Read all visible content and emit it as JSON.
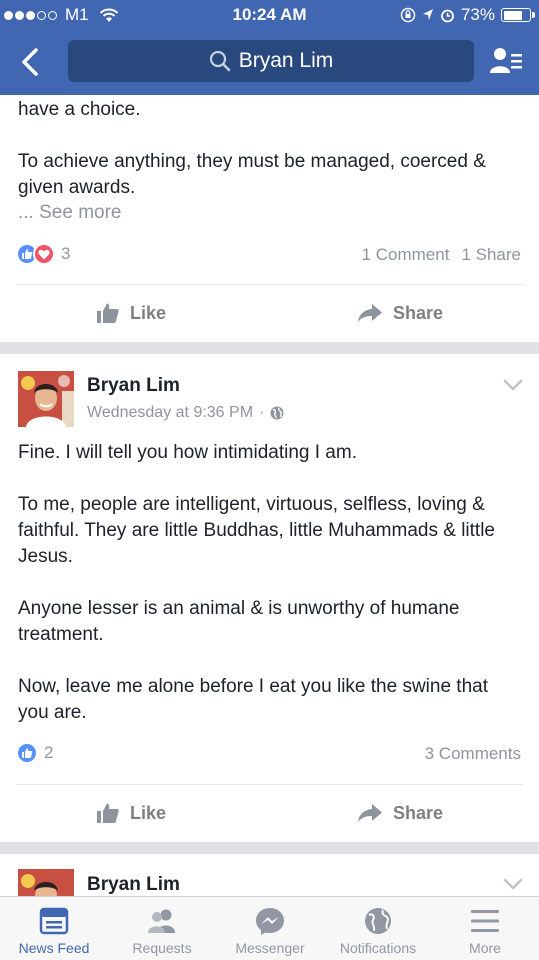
{
  "status_bar": {
    "carrier": "M1",
    "time": "10:24 AM",
    "battery": "73%",
    "battery_level": 0.73
  },
  "header": {
    "search_text": "Bryan Lim"
  },
  "posts": [
    {
      "text_lines": [
        "have a choice.",
        "",
        "To achieve anything, they must be managed, coerced & given awards."
      ],
      "see_more": "... See more",
      "reaction_count": "3",
      "comments": "1 Comment",
      "shares": "1 Share",
      "actions": {
        "like": "Like",
        "share": "Share"
      }
    },
    {
      "author": "Bryan Lim",
      "timestamp": "Wednesday at 9:36 PM",
      "separator": "·",
      "paragraphs": [
        "Fine. I will tell you how intimidating I am.",
        "To me, people are intelligent, virtuous, selfless, loving & faithful. They are little Buddhas, little Muhammads & little Jesus.",
        "Anyone lesser is an animal & is unworthy of humane treatment.",
        "Now, leave me alone before I eat you like the swine that you are."
      ],
      "reaction_count": "2",
      "comments": "3 Comments",
      "actions": {
        "like": "Like",
        "share": "Share"
      }
    },
    {
      "author": "Bryan Lim"
    }
  ],
  "tab_bar": {
    "items": [
      {
        "label": "News Feed",
        "icon": "news-feed-icon",
        "active": true
      },
      {
        "label": "Requests",
        "icon": "friend-requests-icon",
        "active": false
      },
      {
        "label": "Messenger",
        "icon": "messenger-icon",
        "active": false
      },
      {
        "label": "Notifications",
        "icon": "globe-icon",
        "active": false
      },
      {
        "label": "More",
        "icon": "menu-icon",
        "active": false
      }
    ]
  },
  "colors": {
    "brand_blue": "#4267b2",
    "search_bg": "#29487d",
    "like_blue": "#5890ff",
    "love_red": "#f25268",
    "muted_text": "#90949c"
  }
}
